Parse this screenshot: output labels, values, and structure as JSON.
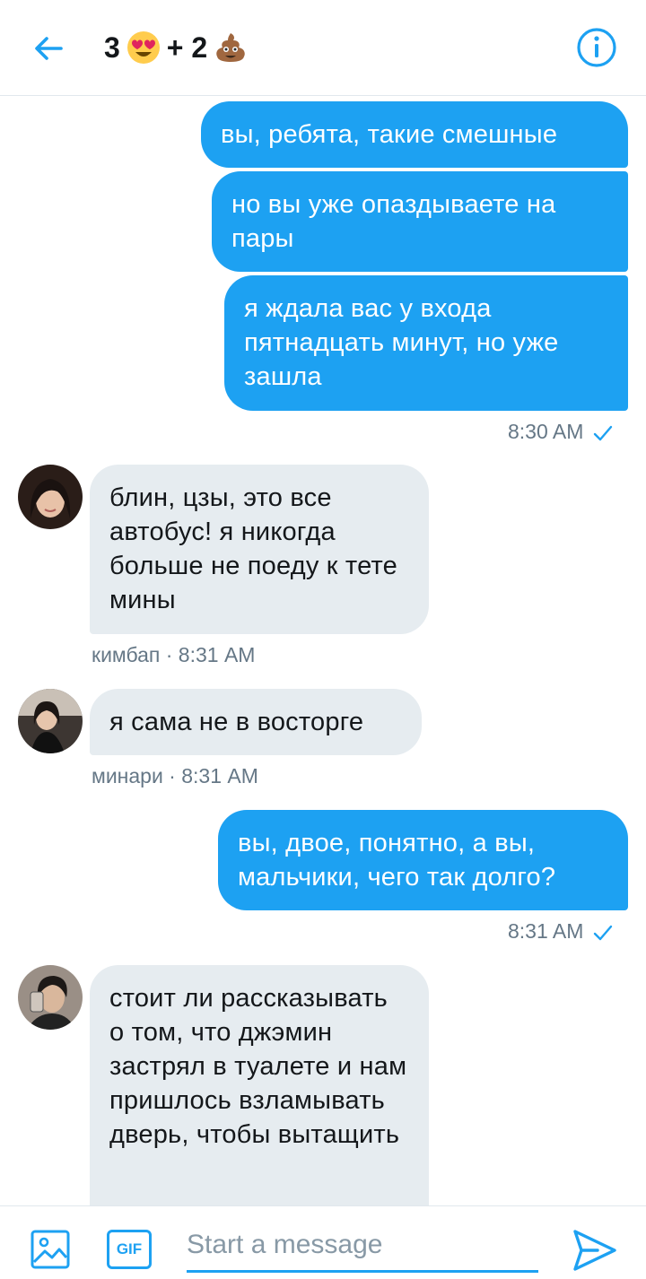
{
  "header": {
    "title_count_1": "3",
    "emoji_1": "heart-eyes-emoji",
    "title_count_2": "+ 2",
    "emoji_2": "poop-emoji"
  },
  "colors": {
    "accent": "#1da1f2",
    "incoming_bubble": "#e6ecf0",
    "meta_text": "#657786"
  },
  "messages": [
    {
      "direction": "out",
      "text": "вы, ребята, такие смешные"
    },
    {
      "direction": "out",
      "text": "но вы уже опаздываете на пары"
    },
    {
      "direction": "out",
      "text": "я ждала вас у входа пятнадцать минут, но уже зашла"
    },
    {
      "direction": "out_time",
      "time": "8:30 AM"
    },
    {
      "direction": "in",
      "sender": "кимбап",
      "text": "блин, цзы, это все автобус! я никогда больше не поеду к тете мины",
      "meta": "кимбап · 8:31 AM"
    },
    {
      "direction": "in",
      "sender": "минари",
      "text": "я сама не в восторге",
      "meta": "минари · 8:31 AM"
    },
    {
      "direction": "out",
      "text": "вы, двое, понятно, а вы, мальчики, чего так долго?"
    },
    {
      "direction": "out_time",
      "time": "8:31 AM"
    },
    {
      "direction": "in",
      "sender": "",
      "text": "стоит ли рассказывать о том, что джэмин застрял в туалете и нам пришлось взламывать дверь, чтобы вытащить"
    }
  ],
  "composer": {
    "placeholder": "Start a message",
    "gif_label": "GIF",
    "media_icon": "image-icon",
    "send_icon": "send-icon"
  }
}
